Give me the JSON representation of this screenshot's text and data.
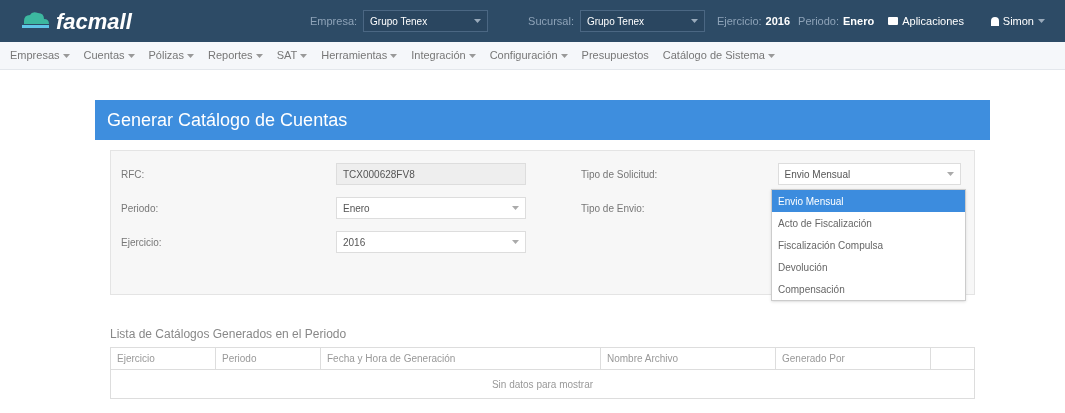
{
  "header": {
    "logo": "facmall",
    "empresa_label": "Empresa:",
    "empresa_value": "Grupo Tenex",
    "sucursal_label": "Sucursal:",
    "sucursal_value": "Grupo Tenex",
    "ejercicio_label": "Ejercicio:",
    "ejercicio_value": "2016",
    "periodo_label": "Periodo:",
    "periodo_value": "Enero",
    "apps": "Aplicaciones",
    "user": "Simon"
  },
  "nav": [
    {
      "label": "Empresas",
      "has_menu": true
    },
    {
      "label": "Cuentas",
      "has_menu": true
    },
    {
      "label": "Pólizas",
      "has_menu": true
    },
    {
      "label": "Reportes",
      "has_menu": true
    },
    {
      "label": "SAT",
      "has_menu": true
    },
    {
      "label": "Herramientas",
      "has_menu": true
    },
    {
      "label": "Integración",
      "has_menu": true
    },
    {
      "label": "Configuración",
      "has_menu": true
    },
    {
      "label": "Presupuestos",
      "has_menu": false
    },
    {
      "label": "Catálogo de Sistema",
      "has_menu": true
    }
  ],
  "panel": {
    "title": "Generar Catálogo de Cuentas"
  },
  "form_left": [
    {
      "label": "RFC:",
      "value": "TCX000628FV8",
      "kind": "readonly"
    },
    {
      "label": "Periodo:",
      "value": "Enero",
      "kind": "select"
    },
    {
      "label": "Ejercicio:",
      "value": "2016",
      "kind": "select"
    }
  ],
  "form_right": [
    {
      "label": "Tipo de Solicitud:",
      "value": "Envio Mensual",
      "kind": "select"
    },
    {
      "label": "Tipo de Envio:",
      "kind": "empty"
    }
  ],
  "dropdown": [
    {
      "label": "Envio Mensual",
      "selected": true
    },
    {
      "label": "Acto de Fiscalización",
      "selected": false
    },
    {
      "label": "Fiscalización Compulsa",
      "selected": false
    },
    {
      "label": "Devolución",
      "selected": false
    },
    {
      "label": "Compensación",
      "selected": false
    }
  ],
  "table": {
    "title": "Lista de Catálogos Generados en el Periodo",
    "columns": [
      "Ejercicio",
      "Periodo",
      "Fecha y Hora de Generación",
      "Nombre Archivo",
      "Generado Por"
    ],
    "empty": "Sin datos para mostrar"
  }
}
